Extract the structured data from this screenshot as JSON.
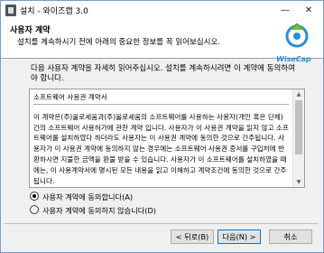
{
  "window": {
    "title": "설치 - 와이즈캡 3.0",
    "minimize_icon": "minimize-icon",
    "close_icon": "close-icon"
  },
  "header": {
    "title": "사용자 계약",
    "subtitle": "설치를 계속하시기 전에 아래의 중요한 정보를 꼭 읽어보십시오.",
    "logo_text": "WiseCap"
  },
  "instructions": "다음 사용자 계약을 자세히 읽어주십시오. 설치를 계속하시려면 이 계약에 동의하여야 합니다.",
  "license": {
    "title": "소프트웨어 사용권 계약서",
    "body": "이 계약은(주)올로세움과(주)올로세움의 소프트웨어를 사용하는 사용자(개인 혹은 단체)간의 소프트웨어 사용허가에 관한 계약 입니다. 사용자가 이 사용권 계약을 읽지 않고 소프트웨어를 설치하였다 하더라도 사용자는 이 사용권 계약에 동의한 것으로 간주됩니다. 사용자가 이 사용권 계약에 동의하지 않는 경우에는 소프트웨어 사용권 증서를 구입처에 반환하시면 지불한 금액을 환불 받을 수 있습니다. 사용자가 이 소프트웨어를 설치하였을 때에는, 이 사용계약서에 명시된 모든 내용을 읽고 이해하고 계약조건에 동의한 것으로 간주됩니다."
  },
  "options": {
    "accept": "사용자 계약에 동의합니다(A)",
    "decline": "사용자 계약에 동의하지 않습니다(D)",
    "selected": "accept"
  },
  "footer": {
    "separator_label": "",
    "back": "< 뒤로(B)",
    "next": "다음(N) >",
    "cancel": "취소"
  }
}
